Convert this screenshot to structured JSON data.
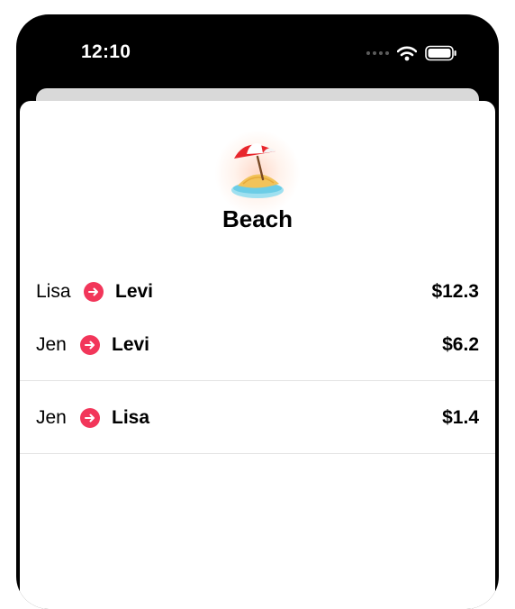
{
  "status_bar": {
    "time": "12:10"
  },
  "group": {
    "emoji": "beach-with-umbrella",
    "title": "Beach"
  },
  "transfers": [
    {
      "from": "Lisa",
      "to": "Levi",
      "amount": "$12.3"
    },
    {
      "from": "Jen",
      "to": "Levi",
      "amount": "$6.2"
    },
    {
      "from": "Jen",
      "to": "Lisa",
      "amount": "$1.4"
    }
  ],
  "colors": {
    "accent": "#F2365A",
    "status_bar": "#000000",
    "sheet": "#FFFFFF"
  }
}
